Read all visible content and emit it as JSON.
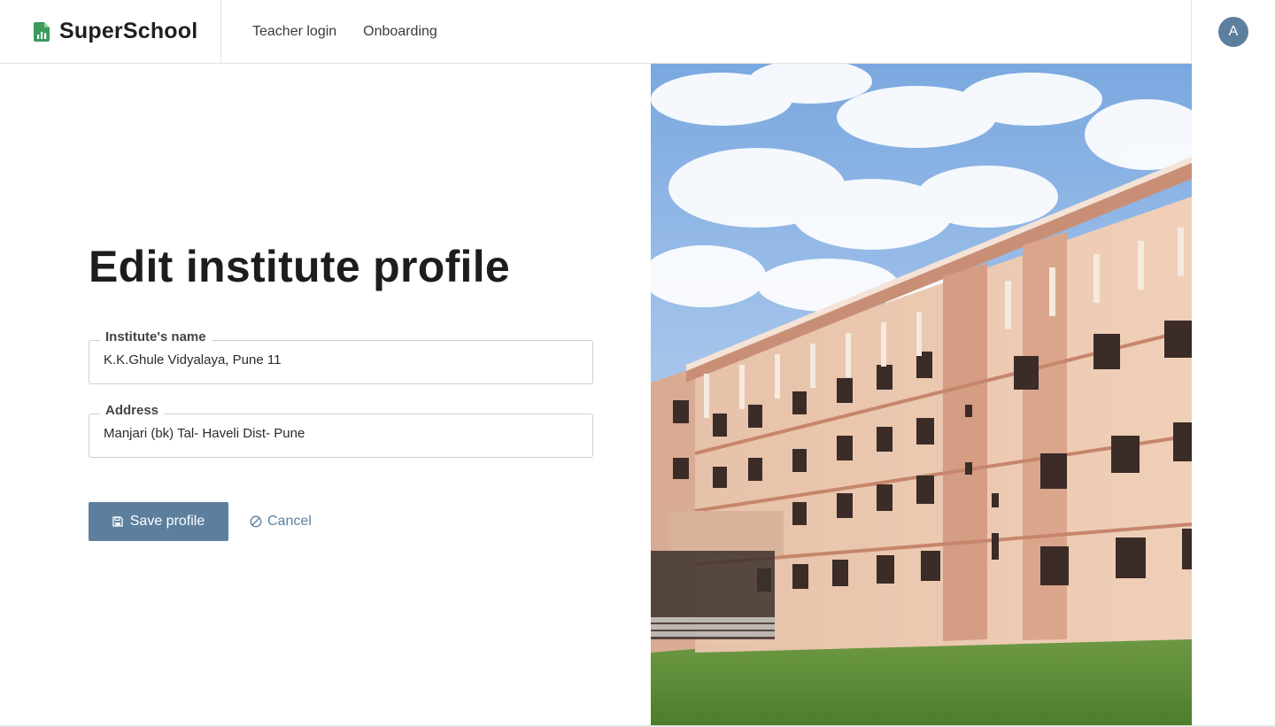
{
  "app": {
    "brand": "SuperSchool",
    "brand_icon": "spreadsheet-chart-icon",
    "brand_color": "#3a9b5b"
  },
  "nav": {
    "items": [
      {
        "label": "Teacher login"
      },
      {
        "label": "Onboarding"
      }
    ]
  },
  "user": {
    "avatar_initial": "A",
    "avatar_color": "#5d7f9e"
  },
  "form": {
    "title": "Edit institute profile",
    "fields": [
      {
        "label": "Institute's name",
        "value": "K.K.Ghule Vidyalaya, Pune 11"
      },
      {
        "label": "Address",
        "value": "Manjari (bk) Tal- Haveli Dist- Pune"
      }
    ],
    "save_label": "Save profile",
    "save_icon": "floppy-disk-icon",
    "cancel_label": "Cancel",
    "cancel_icon": "ban-icon",
    "accent_color": "#5d7f9e"
  },
  "photo": {
    "subject": "school-building-photo"
  }
}
